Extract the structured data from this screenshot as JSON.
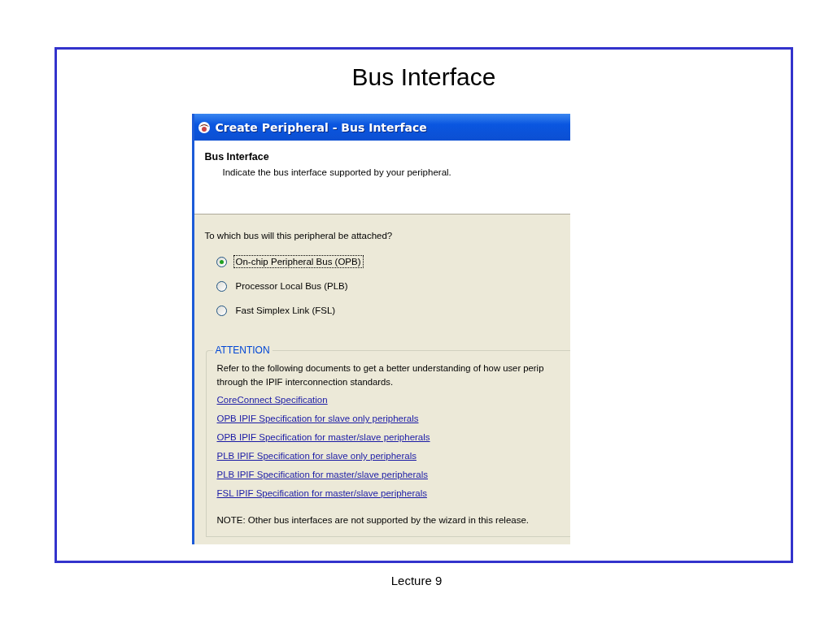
{
  "slide": {
    "title": "Bus Interface",
    "footer": "Lecture 9"
  },
  "window": {
    "title": "Create Peripheral - Bus Interface"
  },
  "header": {
    "title": "Bus Interface",
    "subtitle": "Indicate the bus interface supported by your peripheral."
  },
  "question": "To which bus will this peripheral be attached?",
  "options": [
    {
      "label": "On-chip Peripheral Bus (OPB)",
      "selected": true,
      "focused": true
    },
    {
      "label": "Processor Local Bus (PLB)",
      "selected": false,
      "focused": false
    },
    {
      "label": "Fast Simplex Link (FSL)",
      "selected": false,
      "focused": false
    }
  ],
  "attention": {
    "legend": "ATTENTION",
    "text_lines": [
      "Refer to the following documents to get a better understanding of how user perip",
      "through the IPIF interconnection standards."
    ],
    "links": [
      "CoreConnect Specification",
      "OPB IPIF Specification for slave only peripherals",
      "OPB IPIF Specification for master/slave peripherals",
      "PLB IPIF Specification for slave only peripherals",
      "PLB IPIF Specification for master/slave peripherals",
      "FSL IPIF Specification for master/slave peripherals"
    ],
    "note": "NOTE: Other bus interfaces are not supported by the wizard in this release."
  }
}
